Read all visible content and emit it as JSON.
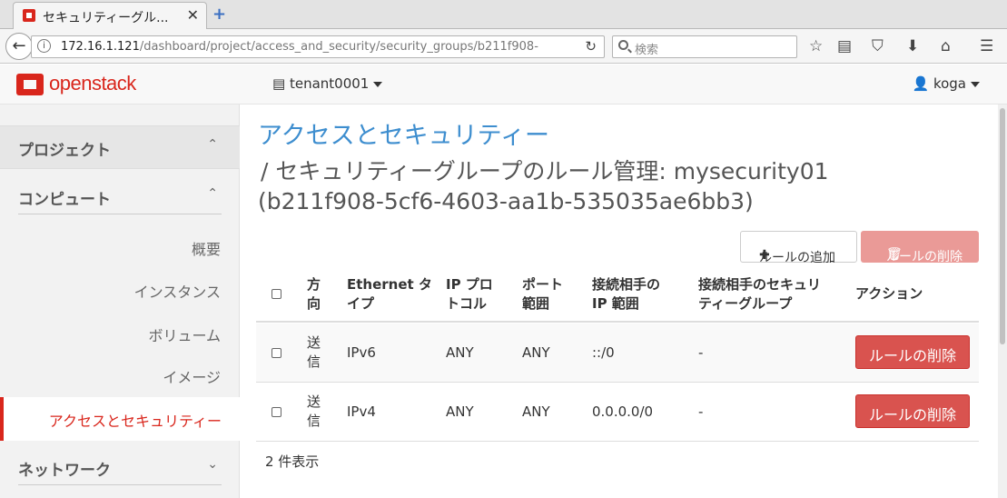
{
  "browser": {
    "tab_title": "セキュリティーグル...",
    "tab_close": "✕",
    "new_tab": "+",
    "url_host": "172.16.1.121",
    "url_path": "/dashboard/project/access_and_security/security_groups/b211f908-",
    "search_placeholder": "検索"
  },
  "header": {
    "logo_text": "openstack",
    "tenant": "tenant0001",
    "user": "koga"
  },
  "sidebar": {
    "project": "プロジェクト",
    "compute": "コンピュート",
    "items": [
      "概要",
      "インスタンス",
      "ボリューム",
      "イメージ"
    ],
    "active_item": "アクセスとセキュリティー",
    "network": "ネットワーク"
  },
  "main": {
    "breadcrumb": "アクセスとセキュリティー",
    "title_line2": "/  セキュリティーグループのルール管理: mysecurity01",
    "title_line3": "(b211f908-5cf6-4603-aa1b-535035ae6bb3)",
    "add_rule": "ルールの追加",
    "delete_rules": "ルールの削除",
    "columns": {
      "direction": [
        "方",
        "向"
      ],
      "ethertype": [
        "Ethernet タ",
        "イプ"
      ],
      "protocol": [
        "IP プロ",
        "トコル"
      ],
      "port": [
        "ポート",
        "範囲"
      ],
      "remote_ip": [
        "接続相手の",
        "IP 範囲"
      ],
      "remote_group": [
        "接続相手のセキュリ",
        "ティーグループ"
      ],
      "actions": "アクション"
    },
    "rows": [
      {
        "direction": [
          "送",
          "信"
        ],
        "ethertype": "IPv6",
        "protocol": "ANY",
        "port": "ANY",
        "remote_ip": "::/0",
        "remote_group": "-",
        "action": "ルールの削除"
      },
      {
        "direction": [
          "送",
          "信"
        ],
        "ethertype": "IPv4",
        "protocol": "ANY",
        "port": "ANY",
        "remote_ip": "0.0.0.0/0",
        "remote_group": "-",
        "action": "ルールの削除"
      }
    ],
    "count": "2 件表示"
  },
  "colors": {
    "brand_red": "#d9261c",
    "link_blue": "#3e8ecf",
    "danger": "#d9534f"
  }
}
